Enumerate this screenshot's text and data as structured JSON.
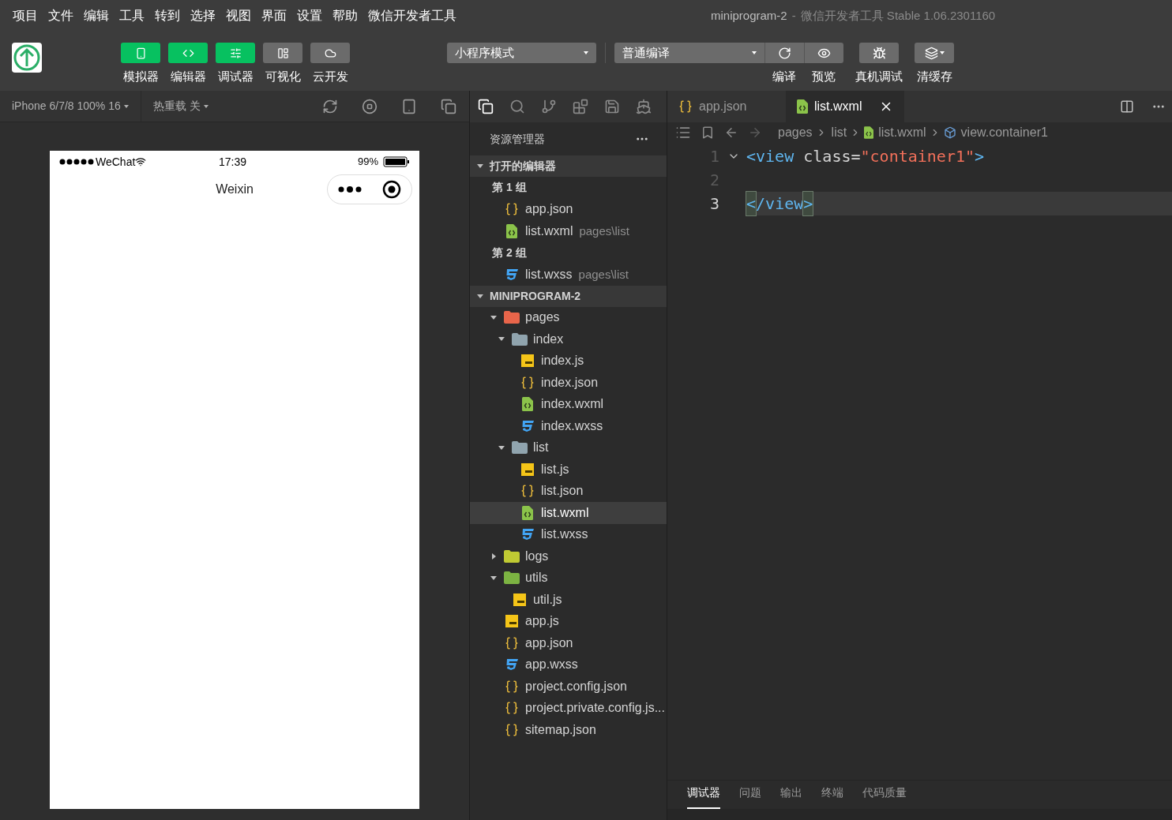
{
  "menu": [
    "项目",
    "文件",
    "编辑",
    "工具",
    "转到",
    "选择",
    "视图",
    "界面",
    "设置",
    "帮助",
    "微信开发者工具"
  ],
  "window_title": {
    "project": "miniprogram-2",
    "separator": "-",
    "app": "微信开发者工具 Stable 1.06.2301160"
  },
  "toolbar": {
    "mode_buttons": [
      {
        "label": "模拟器",
        "kind": "phone",
        "on": true
      },
      {
        "label": "编辑器",
        "kind": "code",
        "on": true
      },
      {
        "label": "调试器",
        "kind": "debug",
        "on": true
      },
      {
        "label": "可视化",
        "kind": "layout",
        "on": false
      },
      {
        "label": "云开发",
        "kind": "cloud",
        "on": false
      }
    ],
    "mode_select": "小程序模式",
    "compile_select": "普通编译",
    "actions": [
      {
        "label": "编译",
        "kind": "compile"
      },
      {
        "label": "预览",
        "kind": "preview"
      },
      {
        "label": "真机调试",
        "kind": "bug"
      },
      {
        "label": "清缓存",
        "kind": "cache"
      }
    ]
  },
  "simulator": {
    "device": "iPhone 6/7/8 100% 16",
    "hot_reload": "热重载 关",
    "phone": {
      "carrier": "WeChat",
      "time": "17:39",
      "battery": "99%",
      "nav_title": "Weixin"
    }
  },
  "explorer": {
    "title": "资源管理器",
    "open_editors": {
      "title": "打开的编辑器",
      "expanded": true,
      "groups": [
        {
          "name": "第 1 组",
          "files": [
            {
              "name": "app.json",
              "kind": "json",
              "selected": false
            },
            {
              "name": "list.wxml",
              "path": "pages\\list",
              "kind": "wxml",
              "selected": false
            }
          ]
        },
        {
          "name": "第 2 组",
          "files": [
            {
              "name": "list.wxss",
              "path": "pages\\list",
              "kind": "wxss",
              "selected": false
            }
          ]
        }
      ]
    },
    "project": {
      "title": "MINIPROGRAM-2",
      "expanded": true,
      "items": [
        {
          "name": "pages",
          "kind": "folder",
          "color": "#e8654a",
          "expanded": true,
          "selected": false,
          "children": [
            {
              "name": "index",
              "kind": "folder",
              "color": "#90a4ae",
              "expanded": true,
              "selected": false,
              "children": [
                {
                  "name": "index.js",
                  "kind": "js",
                  "selected": false
                },
                {
                  "name": "index.json",
                  "kind": "json",
                  "selected": false
                },
                {
                  "name": "index.wxml",
                  "kind": "wxml",
                  "selected": false
                },
                {
                  "name": "index.wxss",
                  "kind": "wxss",
                  "selected": false
                }
              ]
            },
            {
              "name": "list",
              "kind": "folder",
              "color": "#90a4ae",
              "expanded": true,
              "selected": false,
              "children": [
                {
                  "name": "list.js",
                  "kind": "js",
                  "selected": false
                },
                {
                  "name": "list.json",
                  "kind": "json",
                  "selected": false
                },
                {
                  "name": "list.wxml",
                  "kind": "wxml",
                  "selected": true
                },
                {
                  "name": "list.wxss",
                  "kind": "wxss",
                  "selected": false
                }
              ]
            }
          ]
        },
        {
          "name": "logs",
          "kind": "folder",
          "color": "#c0ca33",
          "expanded": false,
          "selected": false
        },
        {
          "name": "utils",
          "kind": "folder",
          "color": "#7cb342",
          "expanded": true,
          "selected": false,
          "children": [
            {
              "name": "util.js",
              "kind": "js",
              "selected": false
            }
          ]
        },
        {
          "name": "app.js",
          "kind": "js",
          "selected": false
        },
        {
          "name": "app.json",
          "kind": "json",
          "selected": false
        },
        {
          "name": "app.wxss",
          "kind": "wxss",
          "selected": false
        },
        {
          "name": "project.config.json",
          "kind": "json",
          "selected": false
        },
        {
          "name": "project.private.config.js...",
          "kind": "json",
          "selected": false
        },
        {
          "name": "sitemap.json",
          "kind": "json",
          "selected": false
        }
      ]
    }
  },
  "editor": {
    "tabs": [
      {
        "label": "app.json",
        "kind": "json",
        "selected": false
      },
      {
        "label": "list.wxml",
        "kind": "wxml",
        "selected": true
      }
    ],
    "breadcrumb": [
      {
        "label": "pages",
        "kind": "folder"
      },
      {
        "label": "list",
        "kind": "folder"
      },
      {
        "label": "list.wxml",
        "kind": "wxml"
      },
      {
        "label": "view.container1",
        "kind": "element"
      }
    ],
    "lines": [
      {
        "number": "1",
        "current": false,
        "foldable": true,
        "tokens": [
          {
            "text": "<view",
            "kind": "tag"
          },
          {
            "text": " class=",
            "kind": "attr"
          },
          {
            "text": "\"container1\"",
            "kind": "string"
          },
          {
            "text": ">",
            "kind": "tag"
          }
        ]
      },
      {
        "number": "2",
        "current": false,
        "foldable": false
      },
      {
        "number": "3",
        "current": true,
        "foldable": false,
        "tokens": [
          {
            "text": "<",
            "kind": "bracket"
          },
          {
            "text": "/view",
            "kind": "tag"
          },
          {
            "text": ">",
            "kind": "bracket"
          }
        ]
      }
    ]
  },
  "panel": {
    "tabs": [
      {
        "label": "调试器",
        "selected": true
      },
      {
        "label": "问题",
        "selected": false
      },
      {
        "label": "输出",
        "selected": false
      },
      {
        "label": "终端",
        "selected": false
      },
      {
        "label": "代码质量",
        "selected": false
      }
    ]
  }
}
